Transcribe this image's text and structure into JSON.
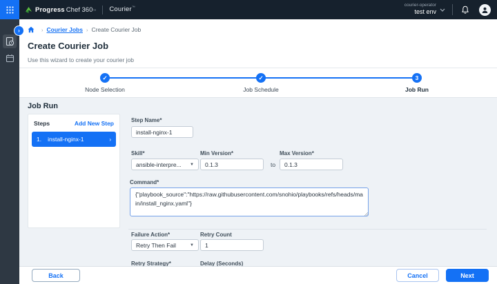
{
  "header": {
    "brand": {
      "progress": "Progress",
      "chef360": "Chef 360",
      "tm": "™",
      "product": "Courier",
      "product_tm": "™"
    },
    "env": {
      "role": "courier-operator",
      "name": "test env"
    }
  },
  "icons": {
    "chevron_down": "⌄",
    "chevron_right": "›",
    "dropdown_arrow": "▼",
    "breadcrumb_separator": "›",
    "check": "✓"
  },
  "breadcrumb": {
    "link": "Courier Jobs",
    "current": "Create Courier Job"
  },
  "page": {
    "title": "Create Courier Job",
    "subtitle": "Use this wizard to create your courier job"
  },
  "stepper": {
    "steps": [
      {
        "label": "Node Selection",
        "glyph": "✓",
        "state": "done"
      },
      {
        "label": "Job Schedule",
        "glyph": "✓",
        "state": "done"
      },
      {
        "label": "Job Run",
        "glyph": "3",
        "state": "current"
      }
    ]
  },
  "job_run": {
    "heading": "Job Run",
    "steps_panel": {
      "title": "Steps",
      "add_link": "Add New Step",
      "selected_step": {
        "index": "1.",
        "name": "install-nginx-1"
      }
    },
    "form": {
      "step_name": {
        "label": "Step Name*",
        "value": "install-nginx-1"
      },
      "skill": {
        "label": "Skill*",
        "value": "ansible-interpre..."
      },
      "min_version": {
        "label": "Min Version*",
        "value": "0.1.3"
      },
      "to_text": "to",
      "max_version": {
        "label": "Max Version*",
        "value": "0.1.3"
      },
      "command": {
        "label": "Command*",
        "value": "{\"playbook_source\":\"https://raw.githubusercontent.com/snohio/playbooks/refs/heads/main/install_nginx.yaml\"}"
      },
      "failure_action": {
        "label": "Failure Action*",
        "value": "Retry Then Fail"
      },
      "retry_count": {
        "label": "Retry Count",
        "value": "1"
      },
      "retry_strategy": {
        "label": "Retry Strategy*"
      },
      "delay": {
        "label": "Delay (Seconds)"
      }
    }
  },
  "footer": {
    "back": "Back",
    "cancel": "Cancel",
    "next": "Next"
  },
  "colors": {
    "accent": "#1471f5",
    "header_bg": "#16212d",
    "sidebar_bg": "#2e3843",
    "section_bg": "#eef2f6",
    "logo_green": "#5cbe3e"
  }
}
